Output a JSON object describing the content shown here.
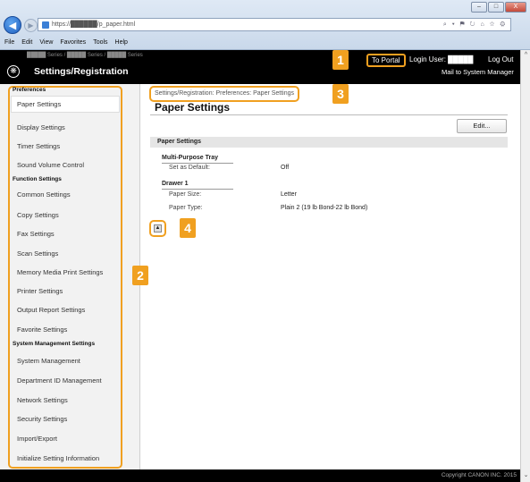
{
  "browser": {
    "url": "https://██████/p_paper.html",
    "toolbar_icons": "⌕ ▾ ⚑ ↻  ⌂ ☆ ⚙",
    "menu": [
      "File",
      "Edit",
      "View",
      "Favorites",
      "Tools",
      "Help"
    ],
    "window_buttons": [
      "–",
      "□",
      "X"
    ]
  },
  "header": {
    "model_line": "█████ Series / █████ Series / █████ Series",
    "title": "Settings/Registration",
    "portal_link": "To Portal",
    "login_user": "Login User: █████",
    "logout": "Log Out",
    "mail": "Mail to System Manager"
  },
  "sidebar": {
    "sections": [
      {
        "heading": "Preferences",
        "items": [
          "Paper Settings",
          "Display Settings",
          "Timer Settings",
          "Sound Volume Control"
        ]
      },
      {
        "heading": "Function Settings",
        "items": [
          "Common Settings",
          "Copy Settings",
          "Fax Settings",
          "Scan Settings",
          "Memory Media Print Settings",
          "Printer Settings",
          "Output Report Settings",
          "Favorite Settings"
        ]
      },
      {
        "heading": "System Management Settings",
        "items": [
          "System Management",
          "Department ID Management",
          "Network Settings",
          "Security Settings",
          "Import/Export",
          "Initialize Setting Information"
        ]
      }
    ]
  },
  "main": {
    "breadcrumb": "Settings/Registration: Preferences: Paper Settings",
    "title": "Paper Settings",
    "edit_button": "Edit...",
    "section_title": "Paper Settings",
    "groups": [
      {
        "name": "Multi-Purpose Tray",
        "rows": [
          {
            "label": "Set as Default:",
            "value": "Off"
          }
        ]
      },
      {
        "name": "Drawer 1",
        "rows": [
          {
            "label": "Paper Size:",
            "value": "Letter"
          },
          {
            "label": "Paper Type:",
            "value": "Plain 2 (19 lb Bond-22 lb Bond)"
          }
        ]
      }
    ],
    "back_to_top_icon": "▲"
  },
  "callouts": [
    "1",
    "2",
    "3",
    "4"
  ],
  "footer": {
    "copyright": "Copyright CANON INC. 2015"
  },
  "colors": {
    "accent": "#f0a020",
    "header_bg": "#000000",
    "sidebar_bg": "#f2f2f2"
  }
}
